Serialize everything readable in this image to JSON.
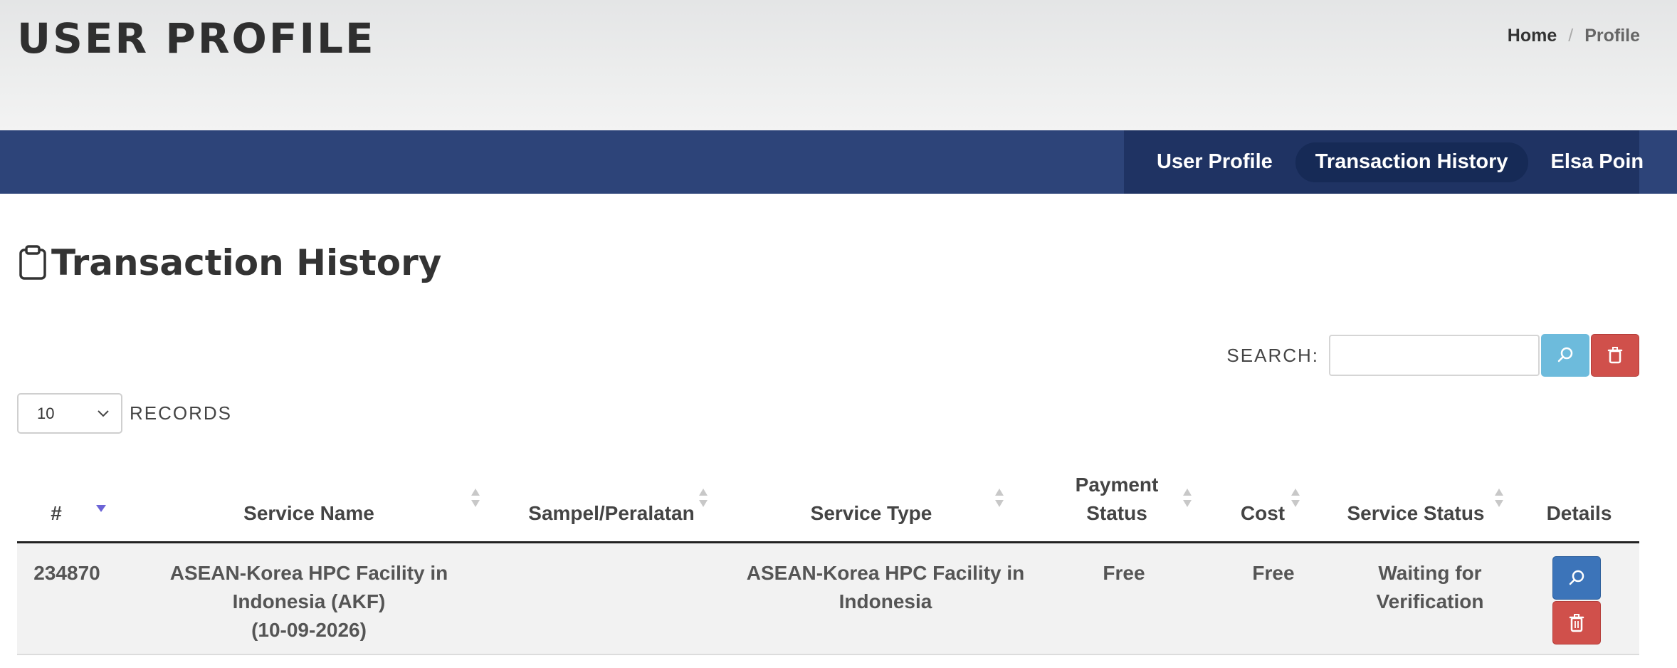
{
  "header": {
    "title": "USER PROFILE",
    "breadcrumb": {
      "home": "Home",
      "separator": "/",
      "current": "Profile"
    }
  },
  "nav": {
    "items": [
      {
        "label": "User Profile",
        "active": false
      },
      {
        "label": "Transaction History",
        "active": true
      },
      {
        "label": "Elsa Poin",
        "active": false
      }
    ]
  },
  "section": {
    "title": "Transaction History",
    "icon": "clipboard-icon"
  },
  "search": {
    "label": "SEARCH:",
    "value": "",
    "placeholder": ""
  },
  "records": {
    "selected": "10",
    "label": "RECORDS"
  },
  "table": {
    "headers": {
      "id": "#",
      "service_name": "Service Name",
      "sample": "Sampel/Peralatan",
      "service_type": "Service Type",
      "payment_status_1": "Payment",
      "payment_status_2": "Status",
      "cost": "Cost",
      "service_status": "Service Status",
      "details": "Details"
    },
    "rows": [
      {
        "id": "234870",
        "service_name_1": "ASEAN-Korea HPC Facility in",
        "service_name_2": "Indonesia (AKF)",
        "service_name_3": "(10-09-2026)",
        "sample": "",
        "service_type_1": "ASEAN-Korea HPC Facility in",
        "service_type_2": "Indonesia",
        "payment_status": "Free",
        "cost": "Free",
        "service_status_1": "Waiting for",
        "service_status_2": "Verification"
      }
    ]
  },
  "colors": {
    "navbar": "#2d4479",
    "nav_group": "#1f3363",
    "nav_active": "#162a56",
    "search_button": "#6dbbdc",
    "danger": "#d0504b",
    "primary": "#3c74b9",
    "sort_active": "#6b63d6"
  }
}
